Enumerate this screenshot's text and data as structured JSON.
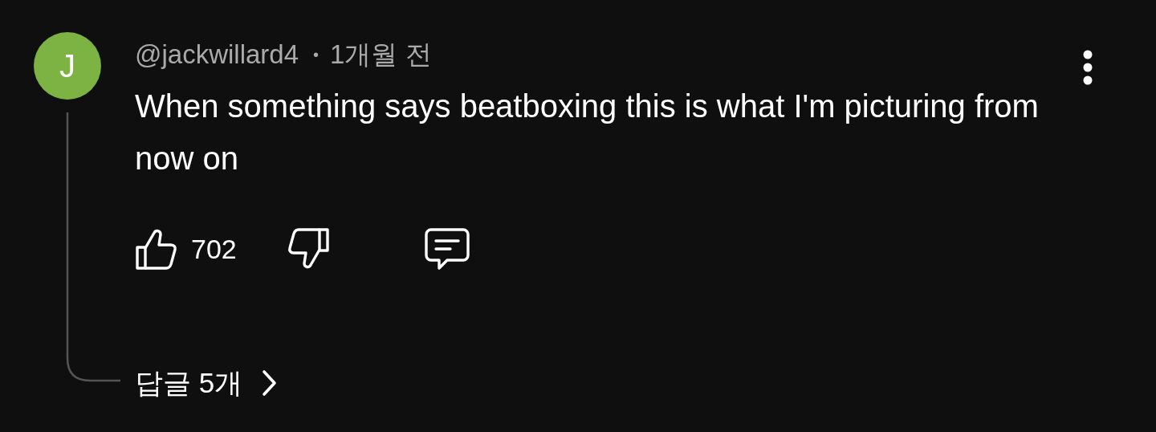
{
  "comment": {
    "avatar_letter": "J",
    "author": "@jackwillard4",
    "separator": "•",
    "time": "1개월 전",
    "text": "When something says beatboxing this is what I'm picturing from now on",
    "likes": "702",
    "replies": "답글 5개"
  }
}
